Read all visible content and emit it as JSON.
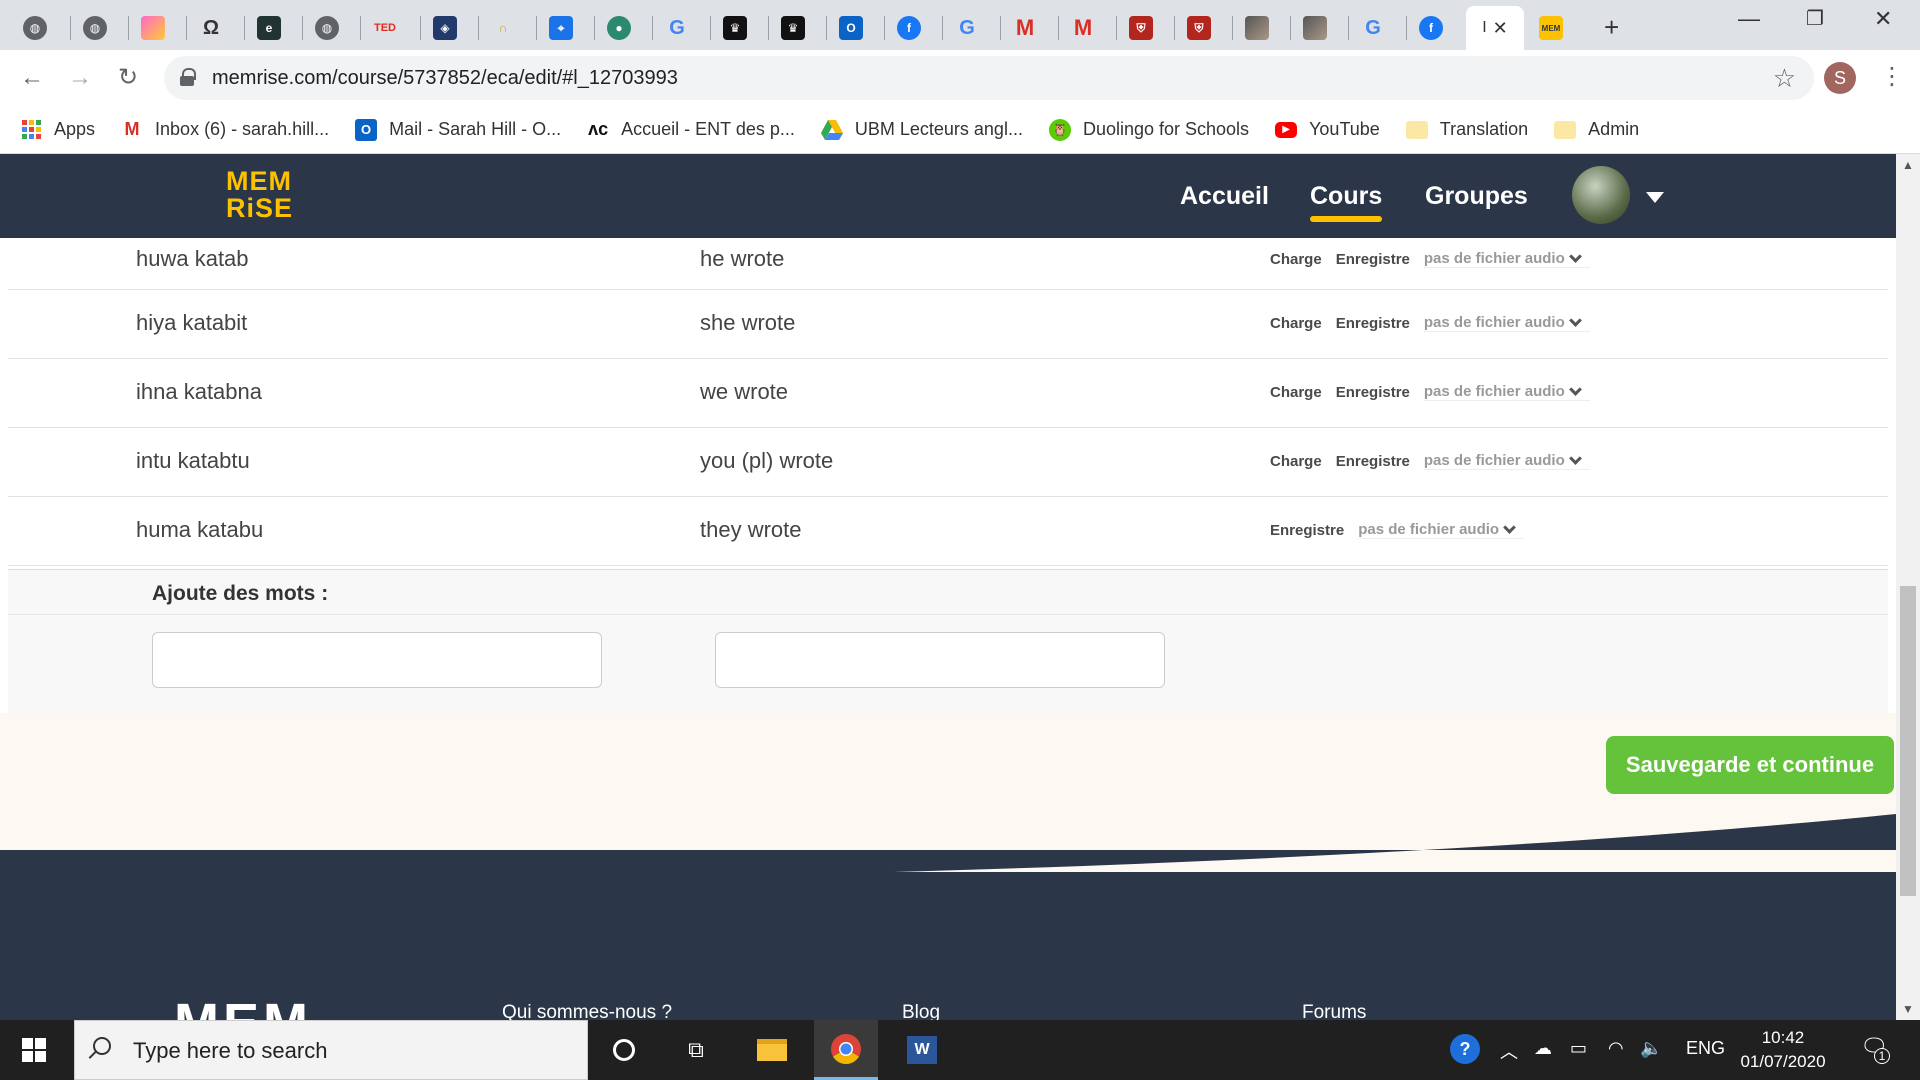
{
  "browser": {
    "active_tab_title": "I",
    "url": "memrise.com/course/5737852/eca/edit/#l_12703993",
    "profile_initial": "S",
    "bookmarks": [
      {
        "label": "Apps",
        "icon": "apps-grid-icon"
      },
      {
        "label": "Inbox (6) - sarah.hill...",
        "icon": "gmail-icon"
      },
      {
        "label": "Mail - Sarah Hill - O...",
        "icon": "outlook-icon"
      },
      {
        "label": "Accueil - ENT des p...",
        "icon": "ent-icon"
      },
      {
        "label": "UBM Lecteurs angl...",
        "icon": "google-drive-icon"
      },
      {
        "label": "Duolingo for Schools",
        "icon": "duolingo-icon"
      },
      {
        "label": "YouTube",
        "icon": "youtube-icon"
      },
      {
        "label": "Translation",
        "icon": "folder-icon"
      },
      {
        "label": "Admin",
        "icon": "folder-icon"
      }
    ]
  },
  "site": {
    "logo_line1": "MEM",
    "logo_line2": "RiSE",
    "nav": [
      "Accueil",
      "Cours",
      "Groupes"
    ],
    "active_nav": "Cours"
  },
  "words": [
    {
      "arabic": "huwa katab",
      "english": "he wrote",
      "charge": "Charge",
      "record": "Enregistre",
      "audio": "pas de fichier audio"
    },
    {
      "arabic": "hiya katabit",
      "english": "she wrote",
      "charge": "Charge",
      "record": "Enregistre",
      "audio": "pas de fichier audio"
    },
    {
      "arabic": "ihna katabna",
      "english": "we wrote",
      "charge": "Charge",
      "record": "Enregistre",
      "audio": "pas de fichier audio"
    },
    {
      "arabic": "intu katabtu",
      "english": "you (pl) wrote",
      "charge": "Charge",
      "record": "Enregistre",
      "audio": "pas de fichier audio"
    },
    {
      "arabic": "huma katabu",
      "english": "they wrote",
      "charge": "",
      "record": "Enregistre",
      "audio": "pas de fichier audio"
    }
  ],
  "add_words": {
    "title": "Ajoute des mots :",
    "input1_value": "",
    "input2_value": ""
  },
  "save_button": "Sauvegarde et continue",
  "footer": {
    "logo": "MEM",
    "links": [
      "Qui sommes-nous ?",
      "Blog",
      "Forums"
    ]
  },
  "taskbar": {
    "search_placeholder": "Type here to search",
    "language": "ENG",
    "time": "10:42",
    "date": "01/07/2020",
    "notification_count": "1"
  },
  "colors": {
    "header_bg": "#2b3648",
    "brand_yellow": "#fcc100",
    "save_green": "#65c23b",
    "cream": "#fdf8f2"
  }
}
